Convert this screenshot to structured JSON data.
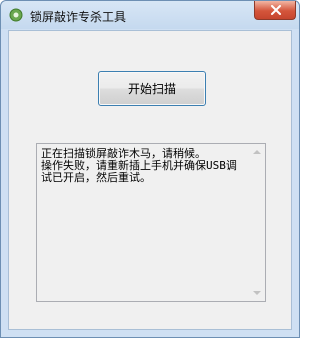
{
  "window": {
    "title": "锁屏敲诈专杀工具",
    "close_icon": "close-icon",
    "app_icon": "green-gear-icon"
  },
  "main": {
    "start_button_label": "开始扫描",
    "log_text": "正在扫描锁屏敲诈木马，请稍候。\n操作失败，请重新插上手机并确保USB调试已开启，然后重试。"
  },
  "colors": {
    "titlebar": "#c5d9ef",
    "client_bg": "#f0f0f0",
    "close_button": "#d4553b",
    "button_border": "#3c7fb1"
  }
}
